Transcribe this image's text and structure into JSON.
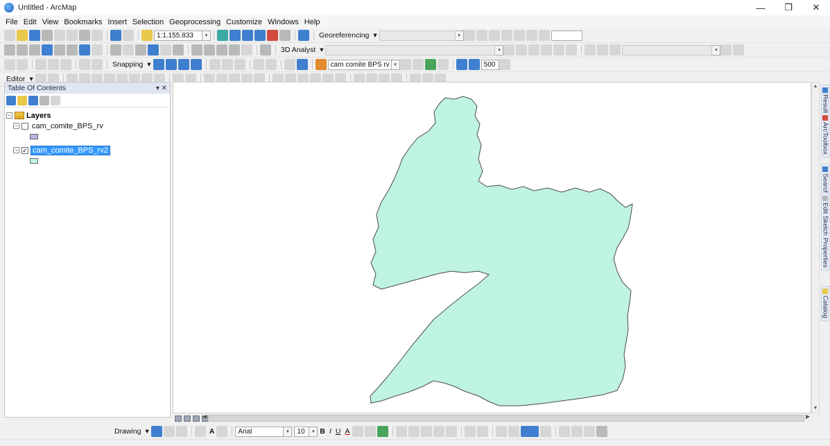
{
  "window": {
    "title": "Untitled - ArcMap",
    "minimize_glyph": "—",
    "maximize_glyph": "❐",
    "close_glyph": "✕"
  },
  "menu": [
    "File",
    "Edit",
    "View",
    "Bookmarks",
    "Insert",
    "Selection",
    "Geoprocessing",
    "Customize",
    "Windows",
    "Help"
  ],
  "standard_toolbar": {
    "scale": "1:1.155.833",
    "georeferencing_label": "Georeferencing",
    "dropdown_glyph": "▾"
  },
  "tools_toolbar": {
    "analyst_label": "3D Analyst"
  },
  "snapping_toolbar": {
    "snapping_label": "Snapping",
    "layer_dropdown_value": "cam comite BPS rv",
    "value_500": "500"
  },
  "editor_toolbar": {
    "editor_label": "Editor"
  },
  "toc": {
    "title": "Table Of Contents",
    "header_controls": "▾ ✕",
    "root_label": "Layers",
    "expand_glyph": "−",
    "layers": [
      {
        "name": "cam_comite_BPS_rv",
        "checked": false,
        "check_glyph": "",
        "swatch_color": "#b8b3e6",
        "selected": false
      },
      {
        "name": "cam_comite_BPS_rv2",
        "checked": true,
        "check_glyph": "✓",
        "swatch_color": "#bff3e3",
        "selected": true
      }
    ]
  },
  "map": {
    "polygon_fill": "#bff3e3",
    "polygon_stroke": "#4a4a4a",
    "background": "#ffffff"
  },
  "right_dock": [
    "Results",
    "ArcToolbox",
    "Search",
    "Edit Sketch Properties",
    "Catalog"
  ],
  "drawing_toolbar": {
    "drawing_label": "Drawing",
    "font_name": "Arial",
    "font_size": "10",
    "bold": "B",
    "italic": "I",
    "underline": "U",
    "font_color_glyph": "A"
  },
  "scroll": {
    "up": "▲",
    "down": "▼",
    "left": "◀",
    "right": "▶"
  }
}
